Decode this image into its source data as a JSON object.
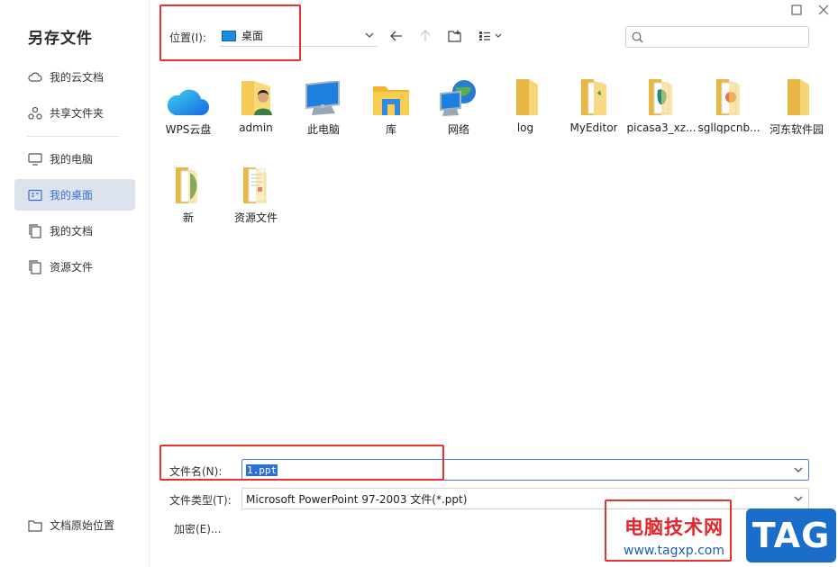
{
  "dialog": {
    "title": "另存文件"
  },
  "sidebar": {
    "items": [
      {
        "label": "我的云文档",
        "icon": "cloud-icon"
      },
      {
        "label": "共享文件夹",
        "icon": "share-folder-icon"
      },
      {
        "label": "我的电脑",
        "icon": "computer-icon"
      },
      {
        "label": "我的桌面",
        "icon": "desktop-icon",
        "active": true
      },
      {
        "label": "我的文档",
        "icon": "documents-icon"
      },
      {
        "label": "资源文件",
        "icon": "resource-folder-icon"
      }
    ],
    "bottom_label": "文档原始位置"
  },
  "toolbar": {
    "location_label": "位置(I):",
    "location_value": "桌面",
    "search_placeholder": ""
  },
  "files": [
    {
      "name": "WPS云盘",
      "icon": "wps-cloud-icon"
    },
    {
      "name": "admin",
      "icon": "user-folder-icon"
    },
    {
      "name": "此电脑",
      "icon": "this-pc-icon"
    },
    {
      "name": "库",
      "icon": "library-icon"
    },
    {
      "name": "网络",
      "icon": "network-icon"
    },
    {
      "name": "log",
      "icon": "folder-icon"
    },
    {
      "name": "MyEditor",
      "icon": "folder-icon"
    },
    {
      "name": "picasa3_xz...",
      "icon": "folder-icon"
    },
    {
      "name": "sgllqpcnb...",
      "icon": "folder-icon"
    },
    {
      "name": "河东软件园",
      "icon": "folder-icon"
    },
    {
      "name": "新",
      "icon": "folder-icon"
    },
    {
      "name": "资源文件",
      "icon": "folder-icon"
    }
  ],
  "form": {
    "filename_label": "文件名(N):",
    "filename_value": "1.ppt",
    "filetype_label": "文件类型(T):",
    "filetype_value": "Microsoft PowerPoint 97-2003 文件(*.ppt)",
    "encrypt_label": "加密(E)..."
  },
  "watermark": {
    "site_name": "电脑技术网",
    "url": "www.tagxp.com",
    "tag": "TAG"
  },
  "colors": {
    "accent": "#3a6ed6",
    "active_bg": "#dde3ec",
    "highlight_red": "#e8322f",
    "folder_yellow": "#f5c955"
  }
}
